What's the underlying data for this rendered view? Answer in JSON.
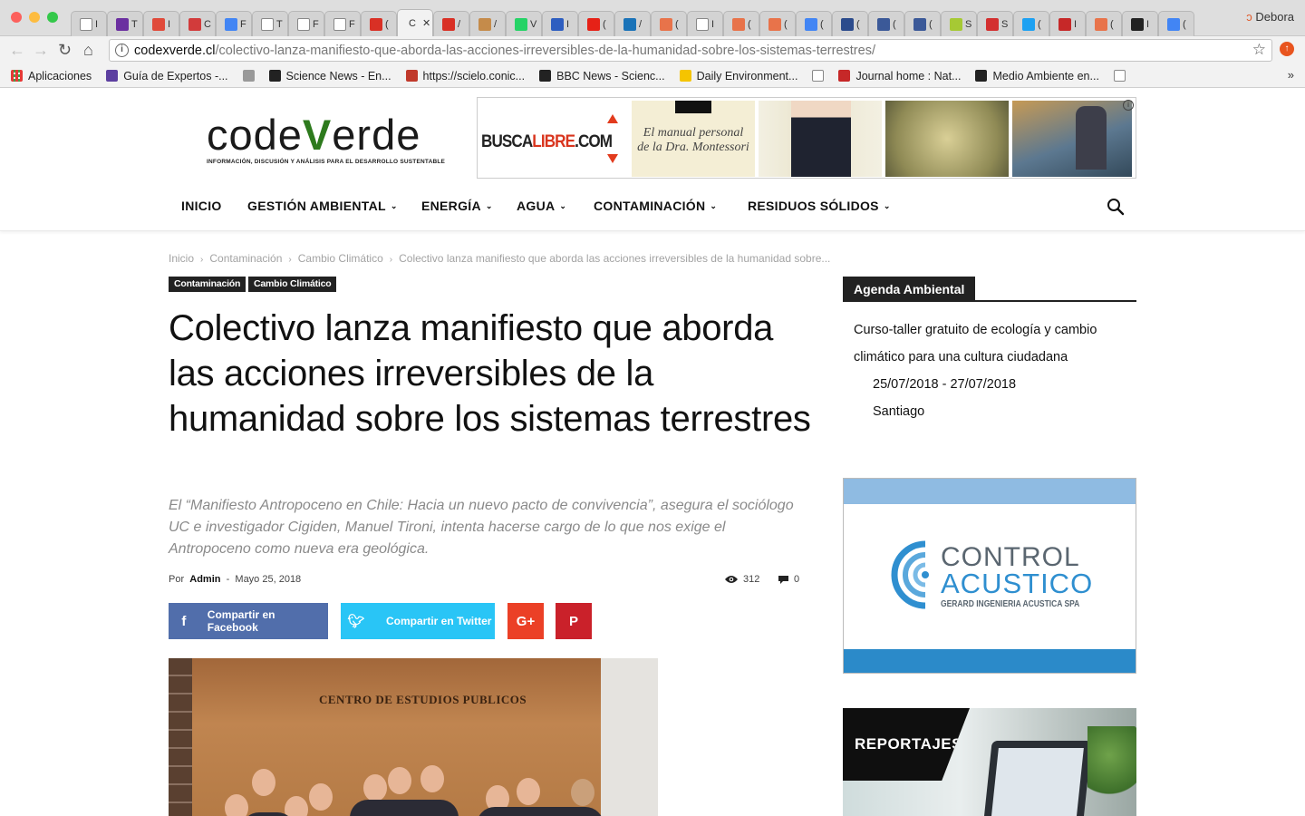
{
  "browser": {
    "profile_name": "Debora",
    "tabs": [
      {
        "title": "I",
        "icon": "doc-icon",
        "color": "#888888"
      },
      {
        "title": "T",
        "icon": "clic-icon",
        "color": "#6b2fa0"
      },
      {
        "title": "I",
        "icon": "dots-icon",
        "color": "#e04a3a"
      },
      {
        "title": "C",
        "icon": "gift-icon",
        "color": "#d23b3b"
      },
      {
        "title": "F",
        "icon": "google-icon",
        "color": "#4285f4"
      },
      {
        "title": "T",
        "icon": "doc-icon",
        "color": "#888888"
      },
      {
        "title": "F",
        "icon": "doc-icon",
        "color": "#888888"
      },
      {
        "title": "F",
        "icon": "doc-icon",
        "color": "#888888"
      },
      {
        "title": "(",
        "icon": "gmail-icon",
        "color": "#d93025"
      },
      {
        "title": "C",
        "icon": "active",
        "color": "#2d7a1d"
      },
      {
        "title": "/",
        "icon": "gmail-icon",
        "color": "#d93025"
      },
      {
        "title": "/",
        "icon": "person-icon",
        "color": "#c58b4a"
      },
      {
        "title": "V",
        "icon": "whatsapp-icon",
        "color": "#25d366"
      },
      {
        "title": "I",
        "icon": "flag-icon",
        "color": "#2e5ec0"
      },
      {
        "title": "(",
        "icon": "youtube-icon",
        "color": "#e62117"
      },
      {
        "title": "/",
        "icon": "pulse-icon",
        "color": "#1a73b8"
      },
      {
        "title": "(",
        "icon": "fingerprint-icon",
        "color": "#e8734a"
      },
      {
        "title": "I",
        "icon": "doc-icon",
        "color": "#888888"
      },
      {
        "title": "(",
        "icon": "fingerprint-icon",
        "color": "#e8734a"
      },
      {
        "title": "(",
        "icon": "fingerprint-icon",
        "color": "#e8734a"
      },
      {
        "title": "(",
        "icon": "google-icon",
        "color": "#4285f4"
      },
      {
        "title": "(",
        "icon": "udd-icon",
        "color": "#2b4b8c"
      },
      {
        "title": "(",
        "icon": "facebook-icon",
        "color": "#3b5998"
      },
      {
        "title": "(",
        "icon": "facebook-icon",
        "color": "#3b5998"
      },
      {
        "title": "S",
        "icon": "slash-icon",
        "color": "#a6c934"
      },
      {
        "title": "S",
        "icon": "s-icon",
        "color": "#d32f2f"
      },
      {
        "title": "(",
        "icon": "twitter-icon",
        "color": "#1da1f2"
      },
      {
        "title": "I",
        "icon": "lt-icon",
        "color": "#c62828"
      },
      {
        "title": "(",
        "icon": "fingerprint-icon",
        "color": "#e8734a"
      },
      {
        "title": "I",
        "icon": "drop-icon",
        "color": "#222222"
      },
      {
        "title": "(",
        "icon": "google-icon",
        "color": "#4285f4"
      }
    ],
    "active_tab_title": "C",
    "url_domain": "codexverde.cl",
    "url_path": "/colectivo-lanza-manifiesto-que-aborda-las-acciones-irreversibles-de-la-humanidad-sobre-los-sistemas-terrestres/",
    "bookmarks": [
      {
        "label": "Aplicaciones",
        "icon": "apps-icon",
        "color": "#e53935"
      },
      {
        "label": "Guía de Expertos -...",
        "icon": "list-icon",
        "color": "#5c3fa0"
      },
      {
        "label": "",
        "icon": "apple-icon",
        "color": "#999999"
      },
      {
        "label": "Science News - En...",
        "icon": "sn-icon",
        "color": "#222222"
      },
      {
        "label": "https://scielo.conic...",
        "icon": "scielo-icon",
        "color": "#c0392b"
      },
      {
        "label": "BBC News - Scienc...",
        "icon": "bbc-icon",
        "color": "#222222"
      },
      {
        "label": "Daily Environment...",
        "icon": "page-icon",
        "color": "#f5c400"
      },
      {
        "label": "",
        "icon": "doc-icon",
        "color": "#888888"
      },
      {
        "label": "Journal home : Nat...",
        "icon": "n-icon",
        "color": "#c62828"
      },
      {
        "label": "Medio Ambiente en...",
        "icon": "e-icon",
        "color": "#222222"
      },
      {
        "label": "",
        "icon": "doc-icon",
        "color": "#888888"
      }
    ]
  },
  "site": {
    "logo_word_pre": "code",
    "logo_word_v": "V",
    "logo_word_post": "erde",
    "logo_tagline": "INFORMACIÓN, DISCUSIÓN Y ANÁLISIS PARA EL DESARROLLO SUSTENTABLE",
    "ad_brand_1": "BUSCA",
    "ad_brand_2": "LIBRE",
    "ad_brand_3": ".COM",
    "ad_book_text": "El manual personal de la Dra. Montessori",
    "nav": [
      {
        "label": "INICIO",
        "dropdown": false
      },
      {
        "label": "GESTIÓN AMBIENTAL",
        "dropdown": true
      },
      {
        "label": "ENERGÍA",
        "dropdown": true
      },
      {
        "label": "AGUA",
        "dropdown": true
      },
      {
        "label": "CONTAMINACIÓN",
        "dropdown": true
      },
      {
        "label": "RESIDUOS SÓLIDOS",
        "dropdown": true
      }
    ]
  },
  "article": {
    "breadcrumb": [
      "Inicio",
      "Contaminación",
      "Cambio Climático",
      "Colectivo lanza manifiesto que aborda las acciones irreversibles de la humanidad sobre..."
    ],
    "categories": [
      "Contaminación",
      "Cambio Climático"
    ],
    "title": "Colectivo lanza manifiesto que aborda las acciones irreversibles de la humanidad sobre los sistemas terrestres",
    "subtitle": "El “Manifiesto Antropoceno en Chile: Hacia un nuevo pacto de convivencia”, asegura el sociólogo UC e investigador Cigiden, Manuel Tironi, intenta hacerse cargo de lo que nos exige el Antropoceno como nueva era geológica.",
    "by_label": "Por",
    "author": "Admin",
    "date_sep": "-",
    "date": "Mayo 25, 2018",
    "views": "312",
    "comments": "0",
    "share_facebook": "Compartir en Facebook",
    "share_twitter": "Compartir en Twitter",
    "image_sign": "CENTRO DE ESTUDIOS PUBLICOS"
  },
  "sidebar": {
    "agenda_heading": "Agenda Ambiental",
    "event_title": "Curso-taller gratuito de ecología y cambio climático para una cultura ciudadana",
    "event_dates": "25/07/2018 - 27/07/2018",
    "event_place": "Santiago",
    "ad_line1": "CONTROL",
    "ad_line2": "ACUSTICO",
    "ad_line3": "GERARD  INGENIERIA ACUSTICA SPA",
    "reportajes_label": "REPORTAJES"
  },
  "colors": {
    "brand_green": "#2d7a1d",
    "facebook": "#516eab",
    "twitter": "#29c5f6",
    "googleplus": "#eb4026",
    "pinterest": "#ca212a"
  }
}
